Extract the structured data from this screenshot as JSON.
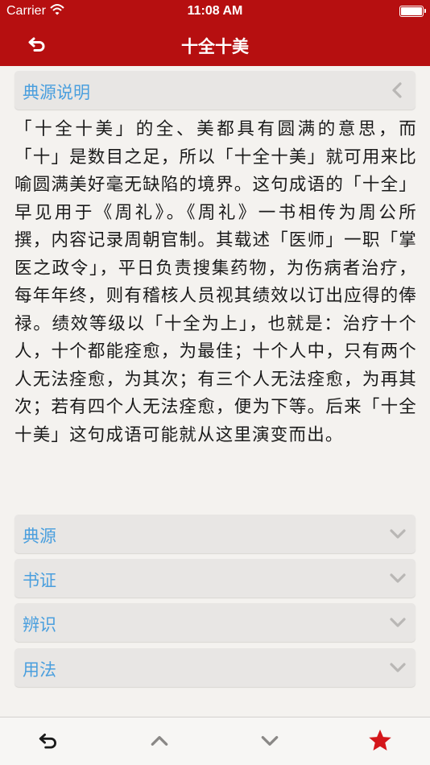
{
  "status_bar": {
    "carrier": "Carrier",
    "time": "11:08 AM"
  },
  "nav_bar": {
    "title": "十全十美",
    "back_icon": "undo-arrow-icon"
  },
  "sections": [
    {
      "label": "典源说明",
      "state": "expanded",
      "icon": "chevron-left-icon"
    },
    {
      "label": "典源",
      "state": "collapsed",
      "icon": "chevron-down-icon"
    },
    {
      "label": "书证",
      "state": "collapsed",
      "icon": "chevron-down-icon"
    },
    {
      "label": "辨识",
      "state": "collapsed",
      "icon": "chevron-down-icon"
    },
    {
      "label": "用法",
      "state": "collapsed",
      "icon": "chevron-down-icon"
    }
  ],
  "explanation": "「十全十美」的全、美都具有圆满的意思，而「十」是数目之足，所以「十全十美」就可用来比喻圆满美好毫无缺陷的境界。这句成语的「十全」早见用于《周礼》。《周礼》一书相传为周公所撰，内容记录周朝官制。其载述「医师」一职「掌医之政令」，平日负责搜集药物，为伤病者治疗，每年年终，则有稽核人员视其绩效以订出应得的俸禄。绩效等级以「十全为上」，也就是：治疗十个人，十个都能痊愈，为最佳；十个人中，只有两个人无法痊愈，为其次；有三个人无法痊愈，为再其次；若有四个人无法痊愈，便为下等。后来「十全十美」这句成语可能就从这里演变而出。",
  "toolbar": {
    "back_icon": "undo-arrow-icon",
    "prev_icon": "chevron-up-icon",
    "next_icon": "chevron-down-icon",
    "favorite_icon": "star-icon"
  },
  "colors": {
    "accent_red": "#b60f10",
    "section_label_blue": "#4a9fde",
    "chevron_gray": "#b9b7b5",
    "star_red": "#d4161a"
  }
}
